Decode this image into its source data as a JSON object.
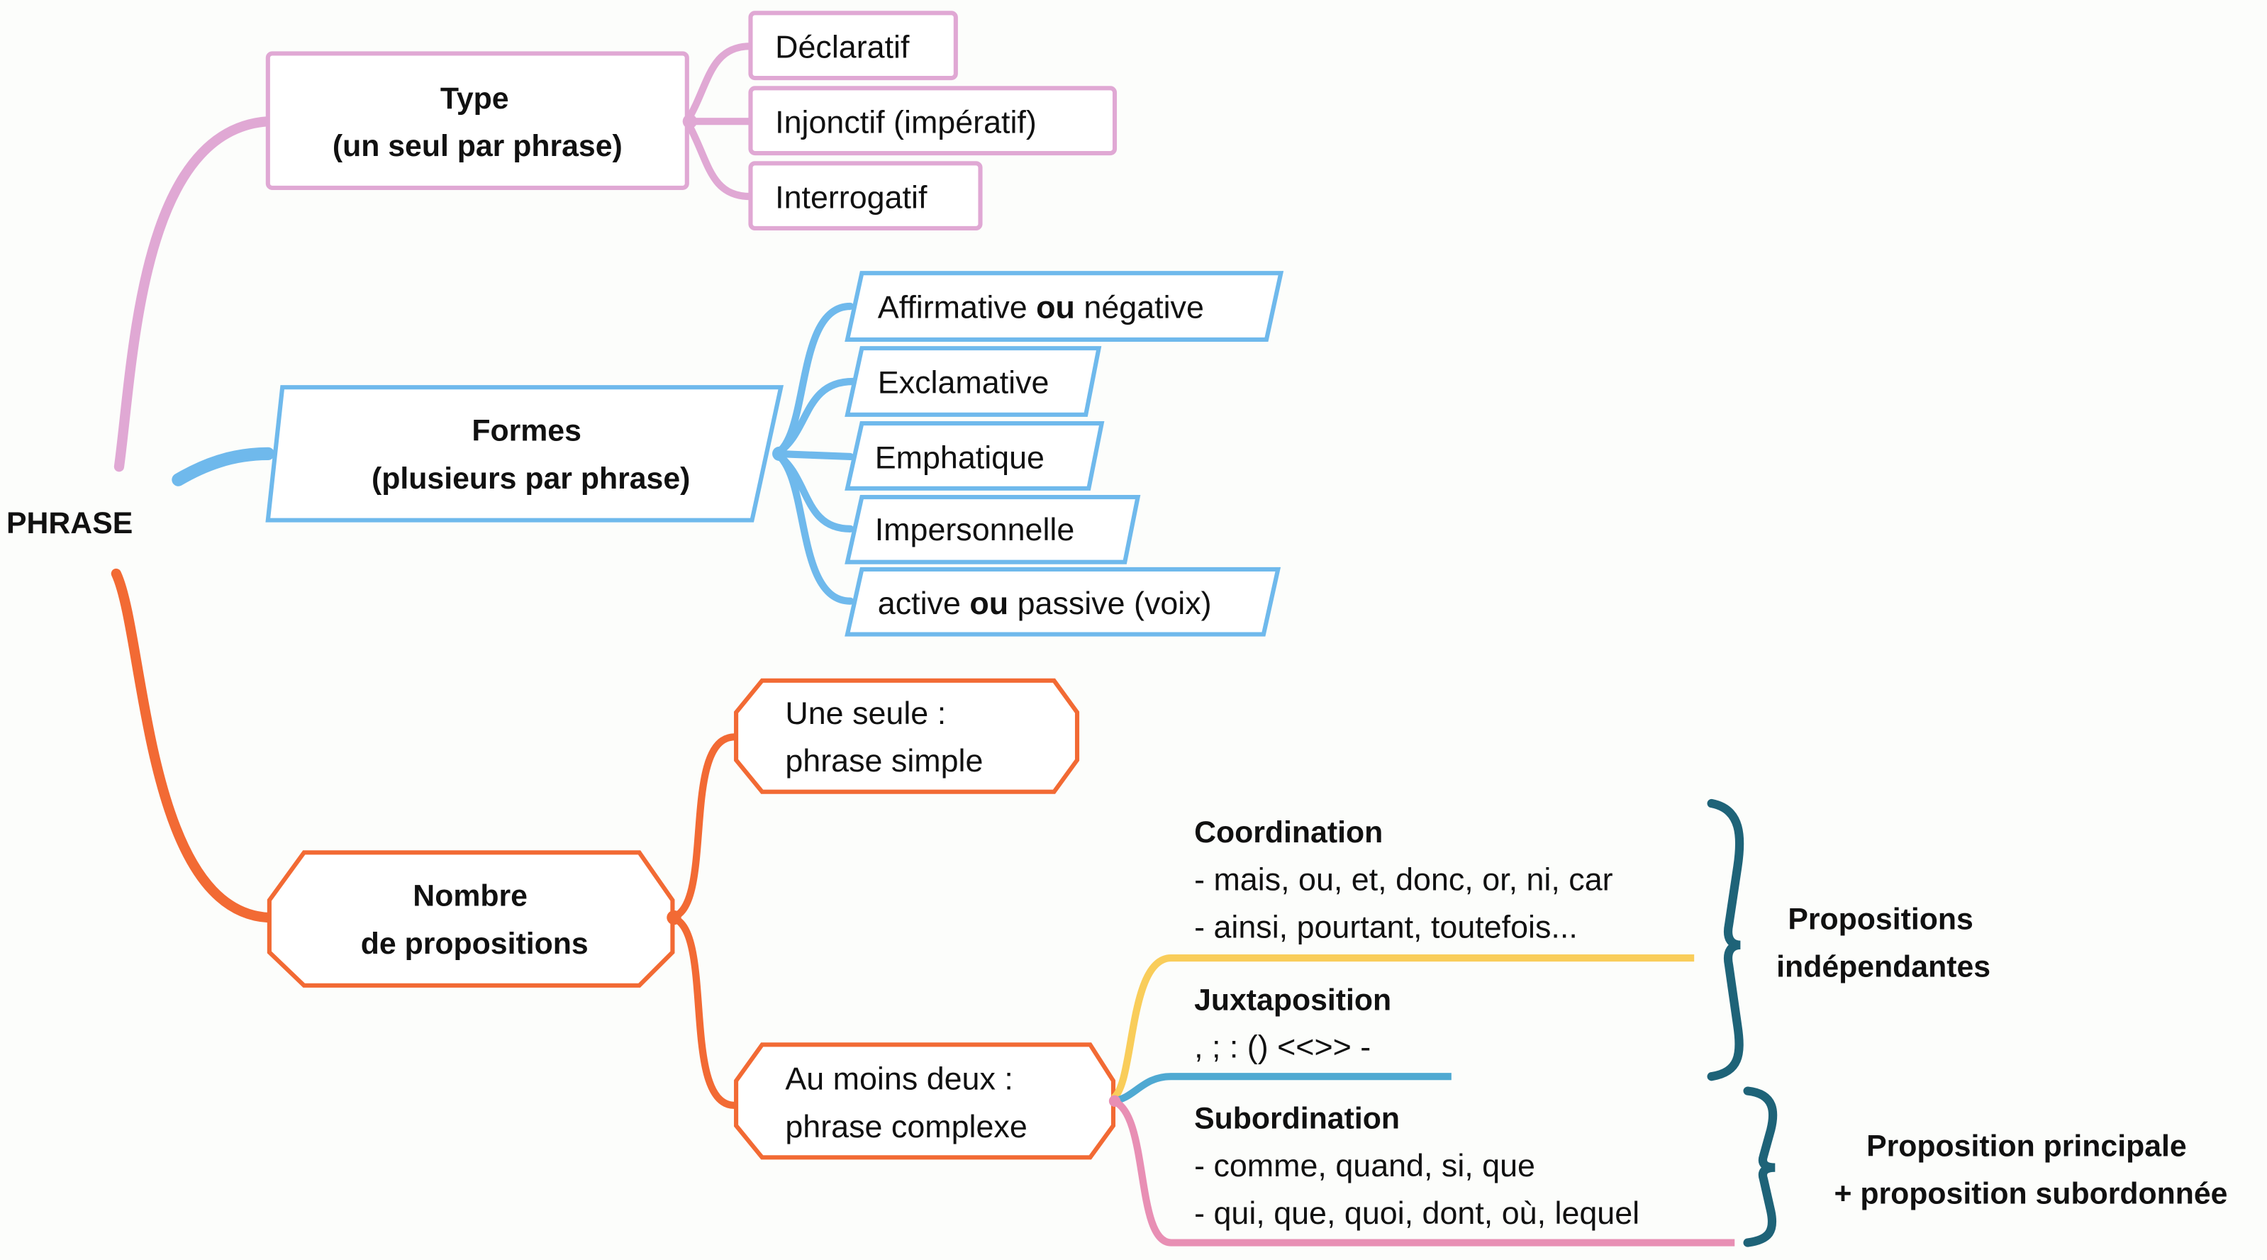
{
  "root": {
    "label": "PHRASE"
  },
  "colors": {
    "type": "#e0a8d4",
    "formes": "#6fb9ec",
    "nombre": "#f26a34",
    "coordination": "#f9cd5a",
    "juxtaposition": "#4fa9d2",
    "subordination": "#e88fb4",
    "brace": "#1e6378",
    "background": "#fcfdfb"
  },
  "type": {
    "title_line1": "Type",
    "title_line2": "(un seul par phrase)",
    "children": [
      {
        "label": "Déclaratif"
      },
      {
        "label": "Injonctif (impératif)"
      },
      {
        "label": "Interrogatif"
      }
    ]
  },
  "formes": {
    "title_line1": "Formes",
    "title_line2": "(plusieurs par phrase)",
    "children": [
      {
        "pre": "Affirmative ",
        "bold": "ou",
        "post": " négative"
      },
      {
        "pre": "Exclamative",
        "bold": "",
        "post": ""
      },
      {
        "pre": "Emphatique",
        "bold": "",
        "post": ""
      },
      {
        "pre": "Impersonnelle",
        "bold": "",
        "post": ""
      },
      {
        "pre": "active ",
        "bold": "ou",
        "post": " passive (voix)"
      }
    ]
  },
  "nombre": {
    "title_line1": "Nombre",
    "title_line2": "de propositions",
    "simple": {
      "line1": "Une seule :",
      "line2": "phrase simple"
    },
    "complexe": {
      "line1": "Au moins deux :",
      "line2": "phrase complexe"
    }
  },
  "complexe_types": {
    "coordination": {
      "title": "Coordination",
      "lines": [
        "- mais, ou, et, donc, or, ni, car",
        "- ainsi, pourtant, toutefois..."
      ]
    },
    "juxtaposition": {
      "title": "Juxtaposition",
      "lines": [
        ", ; : () <<>> -"
      ]
    },
    "subordination": {
      "title": "Subordination",
      "lines": [
        "- comme, quand, si, que",
        "- qui, que, quoi, dont, où, lequel"
      ]
    }
  },
  "results": {
    "independantes": {
      "line1": "Propositions",
      "line2": "indépendantes"
    },
    "principale": {
      "line1": "Proposition principale",
      "line2": "+ proposition subordonnée"
    }
  }
}
